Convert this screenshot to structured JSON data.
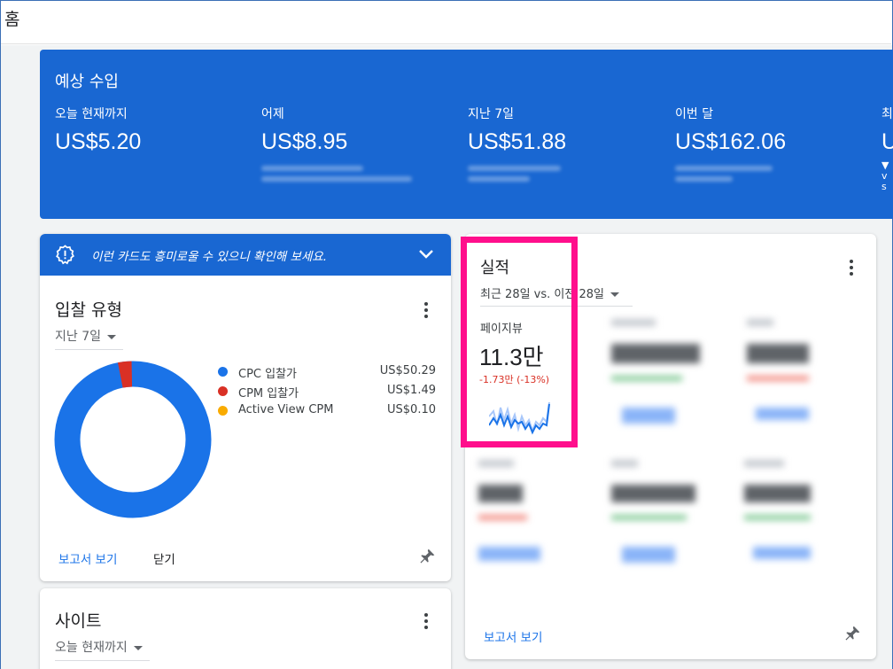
{
  "page": {
    "title": "홈"
  },
  "earnings": {
    "heading": "예상 수입",
    "metrics": [
      {
        "label": "오늘 현재까지",
        "value": "US$5.20"
      },
      {
        "label": "어제",
        "value": "US$8.95"
      },
      {
        "label": "지난 7일",
        "value": "US$51.88"
      },
      {
        "label": "이번 달",
        "value": "US$162.06"
      },
      {
        "label": "최",
        "value": "U",
        "sub": "▼ vs"
      }
    ]
  },
  "bid_card": {
    "banner_text": "이런 카드도 흥미로울 수 있으니 확인해 보세요.",
    "title": "입찰 유형",
    "range": "지난 7일",
    "legend": [
      {
        "name": "CPC 입찰가",
        "amount": "US$50.29",
        "color": "#1a73e8"
      },
      {
        "name": "CPM 입찰가",
        "amount": "US$1.49",
        "color": "#d93025"
      },
      {
        "name": "Active View CPM",
        "amount": "US$0.10",
        "color": "#f9ab00"
      }
    ],
    "report_link": "보고서 보기",
    "close_label": "닫기"
  },
  "site_card": {
    "title": "사이트",
    "range": "오늘 현재까지"
  },
  "perf_card": {
    "title": "실적",
    "range": "최근 28일 vs. 이전 28일",
    "metric_label": "페이지뷰",
    "metric_value": "11.3만",
    "metric_change": "-1.73만 (-13%)",
    "report_link": "보고서 보기"
  },
  "colors": {
    "primary": "#1967d2",
    "link": "#1a73e8",
    "negative": "#d93025",
    "highlight": "#ff0f8c"
  }
}
